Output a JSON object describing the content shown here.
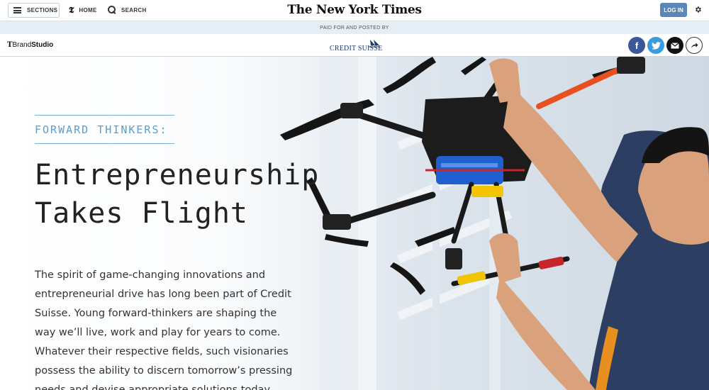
{
  "topbar": {
    "sections_label": "SECTIONS",
    "home_label": "HOME",
    "search_label": "SEARCH",
    "masthead": "The New York Times",
    "login_label": "LOG IN"
  },
  "sponsor": {
    "paid_label": "PAID FOR AND POSTED BY",
    "brand_studio_prefix": "T",
    "brand_studio_brand": "Brand",
    "brand_studio_studio": "Studio",
    "sponsor_name": "CREDIT SUISSE"
  },
  "share": {
    "facebook_glyph": "f"
  },
  "article": {
    "kicker": "FORWARD THINKERS:",
    "headline": "Entrepreneurship Takes Flight",
    "body": "The spirit of game-changing innovations and entrepreneurial drive has long been part of Credit Suisse. Young forward-thinkers are shaping the way we’ll live, work and play for years to come. Whatever their respective fields, such visionaries possess the ability to discern tomorrow’s pressing needs and devise appropriate solutions today."
  },
  "colors": {
    "accent": "#5b9ecf",
    "login_button": "#5a87b8",
    "facebook": "#3b5998",
    "twitter": "#3a9be0"
  },
  "icons": [
    "menu-icon",
    "nyt-t-icon",
    "search-icon",
    "gear-icon",
    "facebook-icon",
    "twitter-icon",
    "email-icon",
    "share-icon"
  ]
}
